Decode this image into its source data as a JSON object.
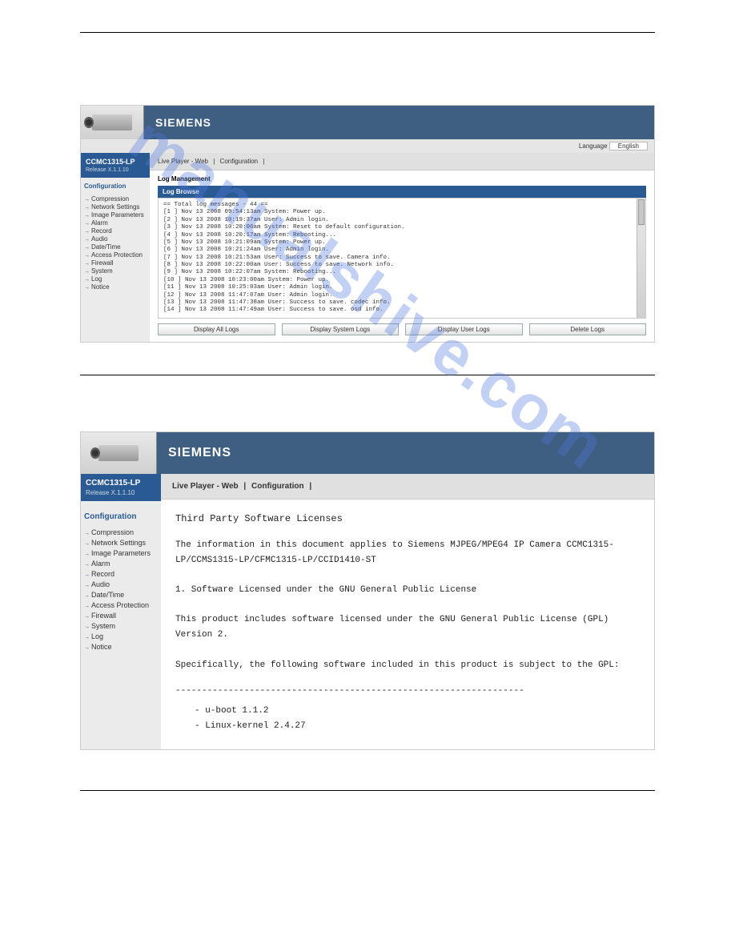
{
  "watermark": "manualshive.com",
  "screenshot1": {
    "brand": "SIEMENS",
    "language_label": "Language",
    "language_value": "English",
    "model": "CCMC1315-LP",
    "release": "Release X.1.1.10",
    "tabs": {
      "live": "Live Player - Web",
      "config": "Configuration"
    },
    "config_title": "Configuration",
    "side_items": [
      "Compression",
      "Network Settings",
      "Image Parameters",
      "Alarm",
      "Record",
      "Audio",
      "Date/Time",
      "Access Protection",
      "Firewall",
      "System",
      "Log",
      "Notice"
    ],
    "section_title": "Log Management",
    "log_browse_title": "Log Browse",
    "log_lines": [
      "== Total log messages - 44 ==",
      "[1   ] Nov 13 2008 09:54:13am System: Power up.",
      "[2   ] Nov 13 2008 10:19:37am User: Admin login.",
      "[3   ] Nov 13 2008 10:20:06am System: Reset to default configuration.",
      "[4   ] Nov 13 2008 10:20:17am System: Rebooting...",
      "[5   ] Nov 13 2008 10:21:09am System: Power up.",
      "[6   ] Nov 13 2008 10:21:24am User: Admin login.",
      "[7   ] Nov 13 2008 10:21:53am User: Success to save. Camera info.",
      "[8   ] Nov 13 2008 10:22:00am User: Success to save. Network info.",
      "[9   ] Nov 13 2008 10:22:07am System: Rebooting...",
      "[10  ] Nov 13 2008 10:23:00am System: Power up.",
      "[11  ] Nov 13 2008 10:25:03am User: Admin login.",
      "[12  ] Nov 13 2008 11:47:07am User: Admin login.",
      "[13  ] Nov 13 2008 11:47:38am User: Success to save. codec info.",
      "[14  ] Nov 13 2008 11:47:49am User: Success to save. osd info."
    ],
    "buttons": {
      "all": "Display All Logs",
      "system": "Display System Logs",
      "user": "Display User Logs",
      "delete": "Delete Logs"
    }
  },
  "screenshot2": {
    "brand": "SIEMENS",
    "model": "CCMC1315-LP",
    "release": "Release X.1.1.10",
    "tabs": {
      "live": "Live Player - Web",
      "config": "Configuration"
    },
    "config_title": "Configuration",
    "side_items": [
      "Compression",
      "Network Settings",
      "Image Parameters",
      "Alarm",
      "Record",
      "Audio",
      "Date/Time",
      "Access Protection",
      "Firewall",
      "System",
      "Log",
      "Notice"
    ],
    "notice": {
      "title": "Third Party Software Licenses",
      "p1": "The information in this document applies to Siemens MJPEG/MPEG4 IP Camera CCMC1315-LP/CCMS1315-LP/CFMC1315-LP/CCID1410-ST",
      "li1": "1.  Software Licensed under the GNU General Public License",
      "p2": "This product includes software licensed under the GNU General Public License (GPL) Version 2.",
      "p3": "Specifically, the following software included in this product is subject to the GPL:",
      "dash": "------------------------------------------------------------------",
      "item1": "- u-boot 1.1.2",
      "item2": "- Linux-kernel 2.4.27"
    }
  }
}
